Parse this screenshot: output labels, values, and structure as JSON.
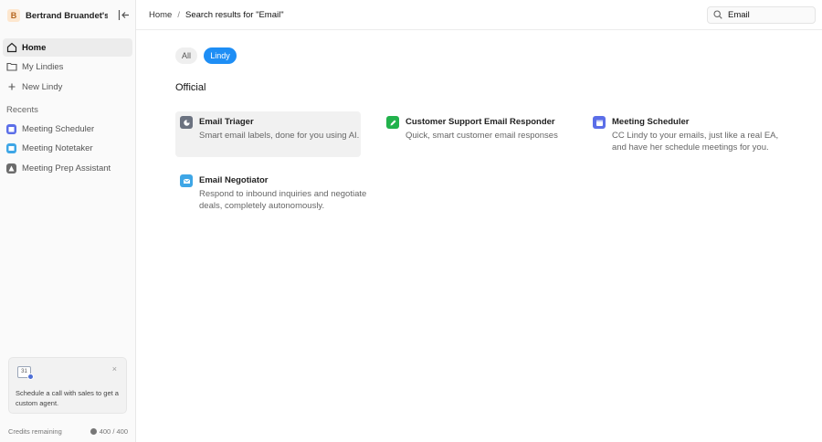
{
  "workspace": {
    "badge": "B",
    "name": "Bertrand Bruandet's..."
  },
  "sidebar": {
    "nav": [
      {
        "label": "Home",
        "icon": "home-icon",
        "active": true
      },
      {
        "label": "My Lindies",
        "icon": "folder-icon",
        "active": false
      },
      {
        "label": "New Lindy",
        "icon": "plus-icon",
        "active": false
      }
    ],
    "recents_label": "Recents",
    "recents": [
      {
        "label": "Meeting Scheduler",
        "icon": "calendar-icon",
        "color": "#5b6ee8"
      },
      {
        "label": "Meeting Notetaker",
        "icon": "notes-icon",
        "color": "#3ea6e6"
      },
      {
        "label": "Meeting Prep Assistant",
        "icon": "prep-icon",
        "color": "#6b6b6b"
      }
    ]
  },
  "promo": {
    "calendar_text": "31",
    "close": "×",
    "text": "Schedule a call with sales to get a custom agent."
  },
  "credits": {
    "label": "Credits remaining",
    "value": "400 / 400"
  },
  "breadcrumb": {
    "home": "Home",
    "sep": "/",
    "current": "Search results for \"Email\""
  },
  "search": {
    "value": "Email"
  },
  "filters": {
    "all": "All",
    "lindy": "Lindy",
    "selected": "Lindy"
  },
  "section_title": "Official",
  "cards": [
    {
      "title": "Email Triager",
      "desc": "Smart email labels, done for you using AI.",
      "icon": "triager-icon",
      "color": "#6b7280"
    },
    {
      "title": "Customer Support Email Responder",
      "desc": "Quick, smart customer email responses",
      "icon": "pencil-icon",
      "color": "#22b24c"
    },
    {
      "title": "Meeting Scheduler",
      "desc": "CC Lindy to your emails, just like a real EA, and have her schedule meetings for you.",
      "icon": "calendar-icon",
      "color": "#5b6ee8"
    },
    {
      "title": "Email Negotiator",
      "desc": "Respond to inbound inquiries and negotiate deals, completely autonomously.",
      "icon": "mail-icon",
      "color": "#3ea6e6"
    }
  ],
  "colors": {
    "accent": "#1e8ef5",
    "sidebar_bg": "#fafafa",
    "highlight": "#f1f1f1"
  }
}
